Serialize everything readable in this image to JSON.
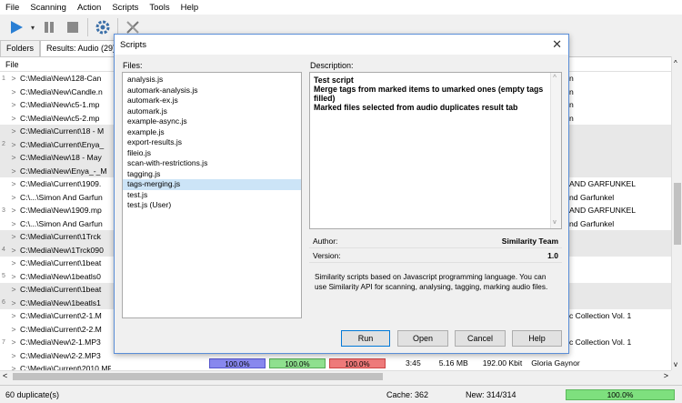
{
  "menu": [
    "File",
    "Scanning",
    "Action",
    "Scripts",
    "Tools",
    "Help"
  ],
  "tabs": [
    "Folders",
    "Results: Audio (29)"
  ],
  "list_header": "File",
  "rows": [
    {
      "grp": false,
      "num": "1",
      "path": "C:\\Media\\New\\128-Can",
      "rt": "n"
    },
    {
      "grp": false,
      "num": "",
      "path": "C:\\Media\\New\\Candle.n",
      "rt": "n"
    },
    {
      "grp": false,
      "num": "",
      "path": "C:\\Media\\New\\c5-1.mp",
      "rt": "n"
    },
    {
      "grp": false,
      "num": "",
      "path": "C:\\Media\\New\\c5-2.mp",
      "rt": "n"
    },
    {
      "grp": true,
      "num": "",
      "path": "C:\\Media\\Current\\18 - M",
      "rt": ""
    },
    {
      "grp": true,
      "num": "2",
      "path": "C:\\Media\\Current\\Enya_",
      "rt": ""
    },
    {
      "grp": true,
      "num": "",
      "path": "C:\\Media\\New\\18 - May",
      "rt": ""
    },
    {
      "grp": true,
      "num": "",
      "path": "C:\\Media\\New\\Enya_-_M",
      "rt": ""
    },
    {
      "grp": false,
      "num": "",
      "path": "C:\\Media\\Current\\1909.",
      "rt": "AND GARFUNKEL"
    },
    {
      "grp": false,
      "num": "",
      "path": "C:\\...\\Simon And Garfun",
      "rt": "nd Garfunkel"
    },
    {
      "grp": false,
      "num": "3",
      "path": "C:\\Media\\New\\1909.mp",
      "rt": "AND GARFUNKEL"
    },
    {
      "grp": false,
      "num": "",
      "path": "C:\\...\\Simon And Garfun",
      "rt": "nd Garfunkel"
    },
    {
      "grp": true,
      "num": "",
      "path": "C:\\Media\\Current\\1Trck",
      "rt": ""
    },
    {
      "grp": true,
      "num": "4",
      "path": "C:\\Media\\New\\1Trck090",
      "rt": ""
    },
    {
      "grp": false,
      "num": "",
      "path": "C:\\Media\\Current\\1beat",
      "rt": ""
    },
    {
      "grp": false,
      "num": "5",
      "path": "C:\\Media\\New\\1beatls0",
      "rt": ""
    },
    {
      "grp": true,
      "num": "",
      "path": "C:\\Media\\Current\\1beat",
      "rt": ""
    },
    {
      "grp": true,
      "num": "6",
      "path": "C:\\Media\\New\\1beatls1",
      "rt": ""
    },
    {
      "grp": false,
      "num": "",
      "path": "C:\\Media\\Current\\2-1.M",
      "rt": "c Collection Vol. 1"
    },
    {
      "grp": false,
      "num": "",
      "path": "C:\\Media\\Current\\2-2.M",
      "rt": ""
    },
    {
      "grp": false,
      "num": "7",
      "path": "C:\\Media\\New\\2-1.MP3",
      "rt": "c Collection Vol. 1"
    },
    {
      "grp": false,
      "num": "",
      "path": "C:\\Media\\New\\2-2.MP3",
      "rt": ""
    },
    {
      "grp": false,
      "num": "",
      "path": "C:\\Media\\Current\\2010.MP3",
      "rt": ""
    }
  ],
  "last_row": {
    "cells": [
      "100.0%",
      "100.0%",
      "100.0%"
    ],
    "duration": "3:45",
    "size": "5.16 MB",
    "bitrate": "192.00 Kbit",
    "artist": "Gloria Gaynor"
  },
  "status": {
    "duplicates": "60 duplicate(s)",
    "cache": "Cache: 362",
    "newcount": "New: 314/314",
    "progress": "100.0%",
    "progress_value": 100
  },
  "dialog": {
    "title": "Scripts",
    "files_label": "Files:",
    "description_label": "Description:",
    "files": [
      "analysis.js",
      "automark-analysis.js",
      "automark-ex.js",
      "automark.js",
      "example-async.js",
      "example.js",
      "export-results.js",
      "fileio.js",
      "scan-with-restrictions.js",
      "tagging.js",
      "tags-merging.js",
      "test.js",
      "test.js (User)"
    ],
    "selected_file": "tags-merging.js",
    "description": [
      "Test script",
      "Merge tags from marked items to umarked ones (empty tags filled)",
      "Marked files selected from audio duplicates result tab"
    ],
    "author_label": "Author:",
    "author_value": "Similarity Team",
    "version_label": "Version:",
    "version_value": "1.0",
    "about_text": "Similarity scripts based on Javascript programming language. You can use Similarity API for scanning, analysing, tagging, marking audio files.",
    "buttons": {
      "run": "Run",
      "open": "Open",
      "cancel": "Cancel",
      "help": "Help"
    }
  },
  "colors": {
    "accent": "#0078d7",
    "selection": "#cce4f7",
    "progress_green": "#7ee07e"
  }
}
